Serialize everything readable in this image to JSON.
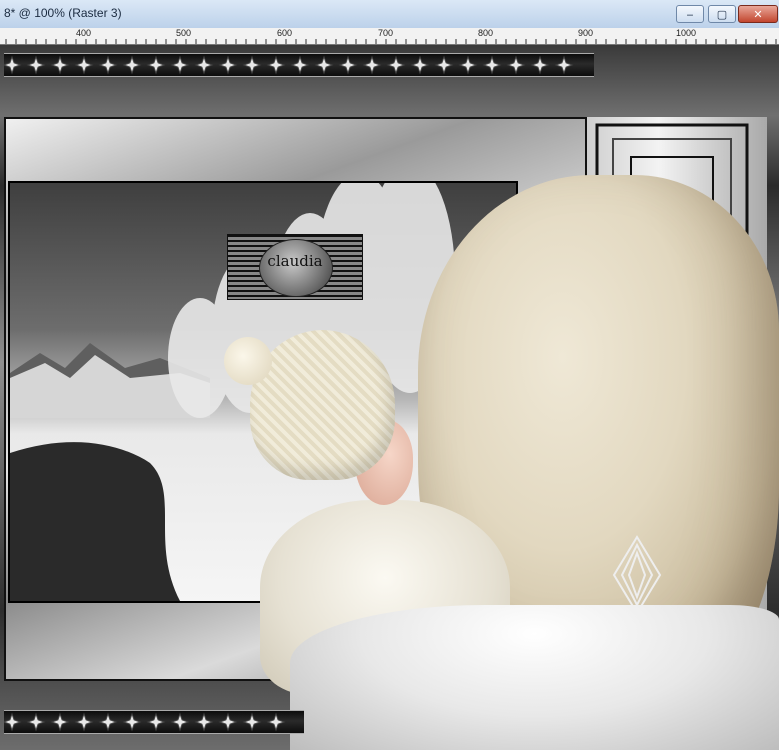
{
  "window": {
    "title": "8* @ 100% (Raster 3)",
    "minimize_glyph": "‒",
    "maximize_glyph": "▢",
    "close_glyph": "✕"
  },
  "ruler": {
    "labels": [
      "400",
      "500",
      "600",
      "700",
      "800",
      "900",
      "1000"
    ]
  },
  "canvas": {
    "watermark_text": "claudia",
    "icons": [
      "star-border-icon",
      "diamond-ornament-icon",
      "logo-seal-icon"
    ]
  }
}
